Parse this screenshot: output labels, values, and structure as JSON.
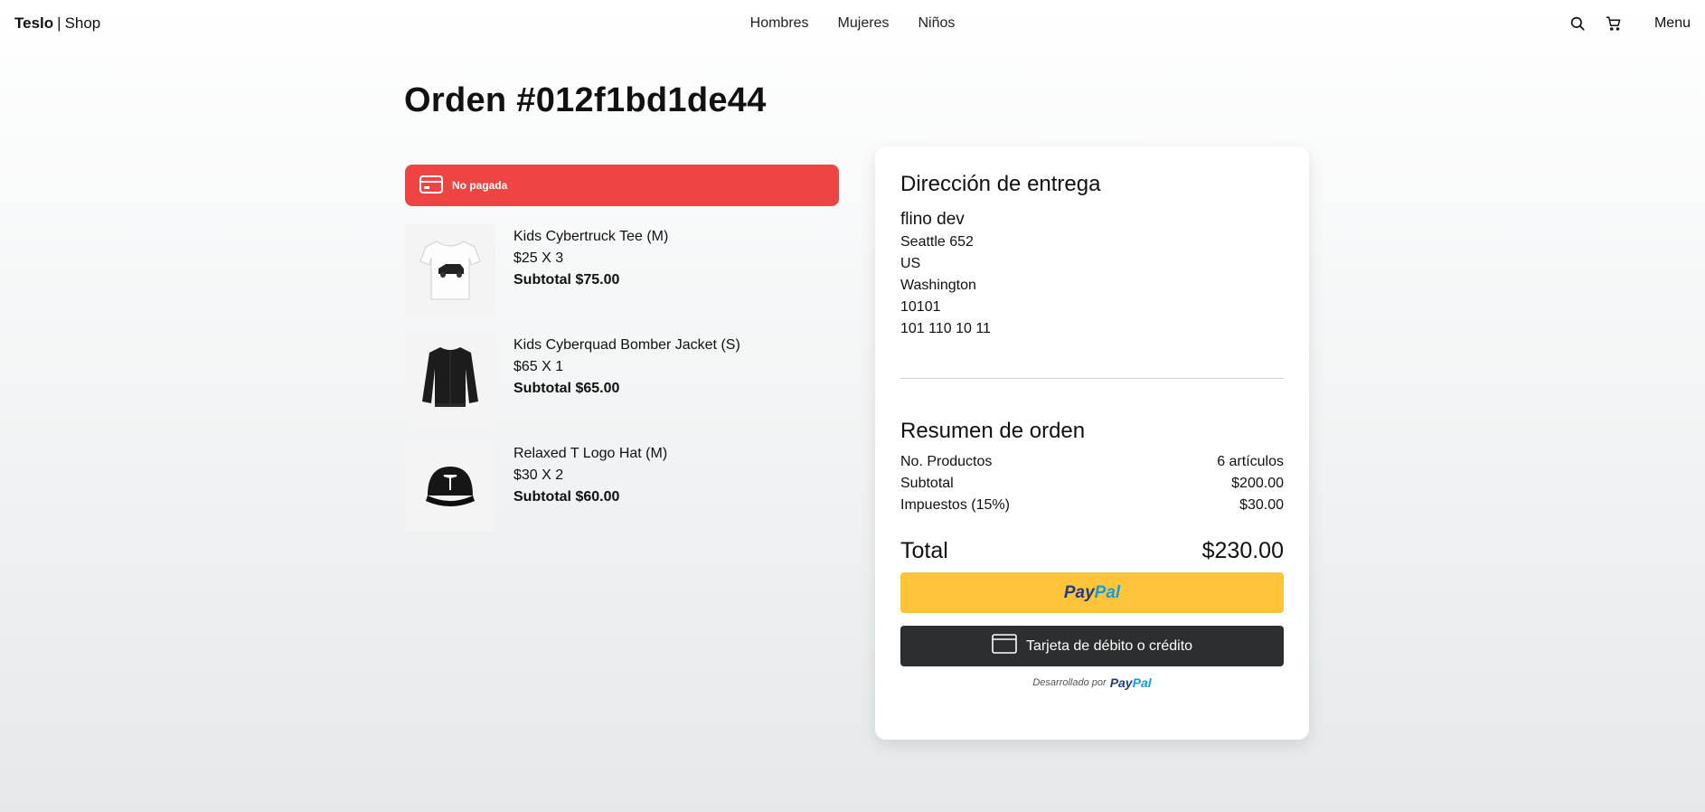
{
  "nav": {
    "brand_main": "Teslo",
    "brand_sep": "|",
    "brand_sub": "Shop",
    "links": [
      "Hombres",
      "Mujeres",
      "Niños"
    ],
    "menu_label": "Menu",
    "icons": [
      "search-icon",
      "cart-icon"
    ]
  },
  "order": {
    "title": "Orden #012f1bd1de44",
    "status_label": "No pagada",
    "status_color": "#ef4444"
  },
  "items": [
    {
      "name": "Kids Cybertruck Tee (M)",
      "price_qty": "$25 X 3",
      "subtotal": "Subtotal $75.00",
      "thumb": "white-tee"
    },
    {
      "name": "Kids Cyberquad Bomber Jacket (S)",
      "price_qty": "$65 X 1",
      "subtotal": "Subtotal $65.00",
      "thumb": "black-jacket"
    },
    {
      "name": "Relaxed T Logo Hat (M)",
      "price_qty": "$30 X 2",
      "subtotal": "Subtotal $60.00",
      "thumb": "black-hat"
    }
  ],
  "address": {
    "heading": "Dirección de entrega",
    "name": "flino dev",
    "line1": "Seattle 652",
    "country": "US",
    "state": "Washington",
    "zip": "10101",
    "phone": "101 110 10 11"
  },
  "summary": {
    "heading": "Resumen de orden",
    "products_label": "No. Productos",
    "products_value": "6 artículos",
    "subtotal_label": "Subtotal",
    "subtotal_value": "$200.00",
    "tax_label": "Impuestos (15%)",
    "tax_value": "$30.00",
    "total_label": "Total",
    "total_value": "$230.00"
  },
  "payment": {
    "paypal_pay": "Pay",
    "paypal_pal": "Pal",
    "card_label": "Tarjeta de débito o crédito",
    "powered_by": "Desarrollado por",
    "paypal_color_dark": "#253b80",
    "paypal_color_light": "#179bd7",
    "paypal_button_color": "#ffc439"
  }
}
